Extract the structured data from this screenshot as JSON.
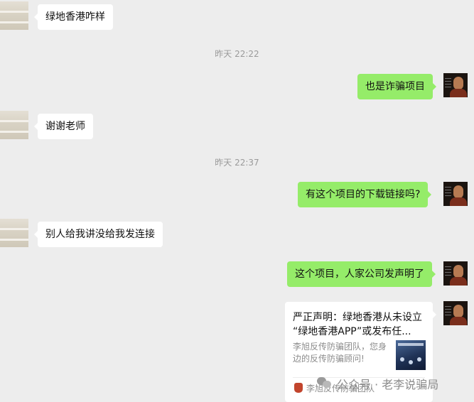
{
  "messages": [
    {
      "side": "in",
      "text": "绿地香港咋样"
    },
    {
      "side": "time",
      "text": "昨天 22:22"
    },
    {
      "side": "out",
      "text": "也是诈骗项目"
    },
    {
      "side": "in",
      "text": "谢谢老师"
    },
    {
      "side": "time",
      "text": "昨天 22:37"
    },
    {
      "side": "out",
      "text": "有这个项目的下载链接吗?"
    },
    {
      "side": "in",
      "text": "别人给我讲没给我发连接"
    },
    {
      "side": "out",
      "text": "这个项目，人家公司发声明了"
    }
  ],
  "card": {
    "title_line1": "严正声明：绿地香港从未设立",
    "title_line2": "“绿地香港APP”或发布任...",
    "desc": "李旭反传防骗团队，您身边的反传防骗顾问!",
    "source": "李旭反传防骗团队"
  },
  "watermark": {
    "text": "公众号 · 老李说骗局"
  },
  "icons": {
    "contact_avatar": "avatar-image",
    "self_avatar": "avatar-image",
    "card_source_icon": "account-logo-icon",
    "watermark_icon": "wechat-icon"
  },
  "colors": {
    "background": "#ededed",
    "outgoing_bubble": "#95ec69",
    "incoming_bubble": "#ffffff",
    "timestamp": "#9a9a9a"
  }
}
